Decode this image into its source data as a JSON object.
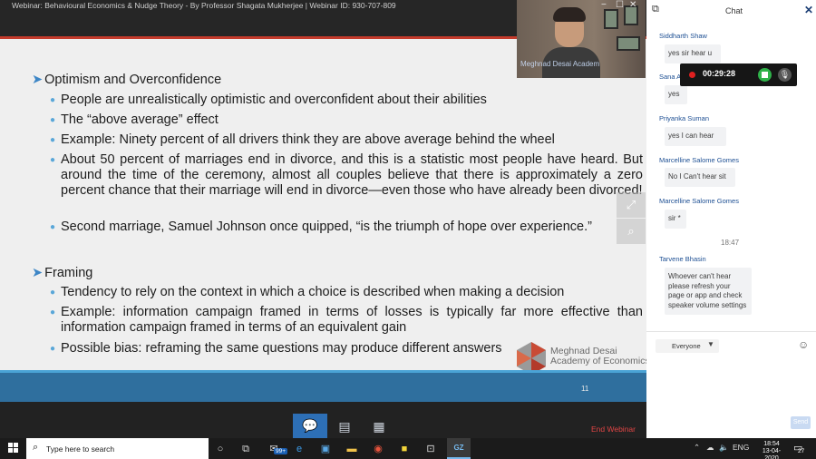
{
  "window": {
    "title": "Webinar: Behavioural Economics & Nudge Theory - By Professor Shagata Mukherjee | Webinar ID: 930-707-809",
    "controls": {
      "minimize": "−",
      "maximize": "☐",
      "close": "✕"
    }
  },
  "slide": {
    "sections": [
      {
        "heading": "Optimism and Overconfidence",
        "bullets": [
          "People are unrealistically optimistic and overconfident about their abilities",
          "The “above average” effect",
          "Example: Ninety percent of all drivers think they are above average behind the wheel",
          "About 50 percent of marriages end in divorce, and this is a statistic most people have heard. But around the time of the ceremony, almost all couples believe that there is approximately a zero percent chance that their marriage will end in divorce—even those who have already been divorced!",
          "Second marriage, Samuel Johnson once quipped, “is the triumph of hope over experience.”"
        ]
      },
      {
        "heading": "Framing",
        "bullets": [
          "Tendency to rely on the context in which a choice is described when making a decision",
          "Example: information campaign framed in terms of losses is typically far more effective than information campaign framed in terms of an equivalent gain",
          "Possible bias: reframing the same questions may produce different answers"
        ]
      }
    ],
    "logo": {
      "line1": "Meghnad Desai",
      "line2": "Academy of Economics"
    },
    "page_number": "11"
  },
  "video": {
    "caption": "Meghnad Desai Academ"
  },
  "recording": {
    "time": "00:29:28"
  },
  "webinar_bar": {
    "end_label": "End Webinar"
  },
  "chat": {
    "title": "Chat",
    "messages": [
      {
        "name": "Siddharth Shaw",
        "text": "yes sir hear u"
      },
      {
        "name": "Sana A",
        "text": "yes"
      },
      {
        "name": "Priyanka  Suman",
        "text": "yes I can hear"
      },
      {
        "name": "Marcelline Salome Gomes",
        "text": "No I Can't hear sit"
      },
      {
        "name": "Marcelline Salome Gomes",
        "text": "sir *"
      },
      {
        "name": "Tarvene Bhasin",
        "text": "Whoever can't hear please refresh your page or app and check speaker volume settings"
      }
    ],
    "time_divider": "18:47",
    "recipient": "Everyone",
    "send_label": "Send"
  },
  "taskbar": {
    "search_placeholder": "Type here to search",
    "mail_badge": "99+",
    "lang": "ENG",
    "time": "18:54",
    "date": "13-04-2020",
    "notification_count": "27",
    "active_app_label": "GZ"
  },
  "colors": {
    "accent": "#2d6fb6",
    "slide_band": "#2f6f9e",
    "chat_name": "#1d4f93",
    "end_webinar": "#e04545"
  }
}
